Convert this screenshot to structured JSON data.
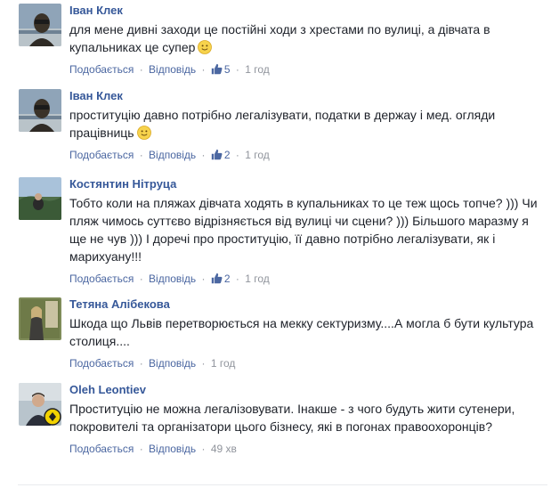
{
  "labels": {
    "like": "Подобається",
    "reply": "Відповідь",
    "separator": "·"
  },
  "colors": {
    "author": "#365899",
    "action_link": "#4b67a1",
    "meta": "#90949c",
    "text": "#1d2129"
  },
  "comments": [
    {
      "author": "Іван Клек",
      "text": "для мене дивні заходи це постійні ходи з хрестами по вулиці, а дівчата в купальниках це супер",
      "emoji": "slightly-smiling-face-icon",
      "reactions": "5",
      "time": "1 год"
    },
    {
      "author": "Іван Клек",
      "text": "проституцію давно потрібно легалізувати, податки в держау і мед. огляди працівниць",
      "emoji": "slightly-smiling-face-icon",
      "reactions": "2",
      "time": "1 год"
    },
    {
      "author": "Костянтин Нітруца",
      "text": "Тобто коли на пляжах дівчата ходять в купальниках то це теж щось топче? ))) Чи пляж чимось суттєво відрізняється від вулиці чи сцени? ))) Більшого маразму я ще не чув ))) І доречі про проституцію, її давно потрібно легалізувати, як і марихуану!!!",
      "reactions": "2",
      "time": "1 год"
    },
    {
      "author": "Тетяна Алібекова",
      "text": "Шкода що Львів перетворюється на мекку сектуризму....А могла б бути культура столиця....",
      "time": "1 год"
    },
    {
      "author": "Oleh Leontiev",
      "text": "Проституцію не можна легалізовувати. Інакше - з чого будуть жити сутенери, покровителі та організатори цього бізнесу, які в погонах правоохоронців?",
      "time": "49 хв"
    }
  ]
}
